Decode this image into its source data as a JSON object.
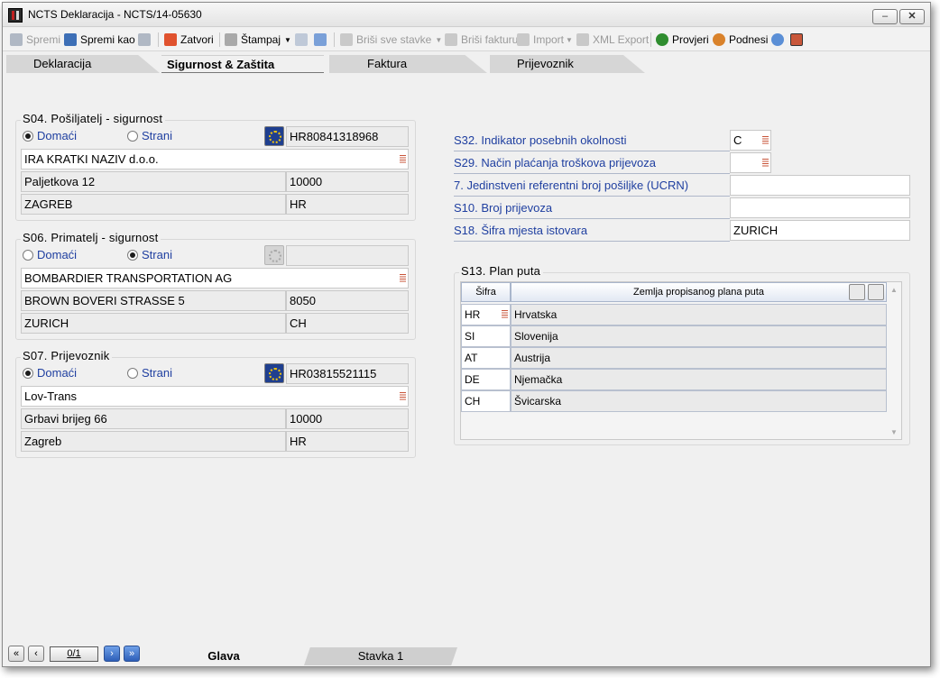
{
  "window": {
    "title": "NCTS Deklaracija - NCTS/14-05630"
  },
  "toolbar": {
    "spremi": "Spremi",
    "spremi_kao": "Spremi kao",
    "zatvori": "Zatvori",
    "stampaj": "Štampaj",
    "brisi_sve_stavke": "Briši sve stavke",
    "brisi_fakturu": "Briši fakturu",
    "import": "Import",
    "xml_export": "XML Export",
    "provjeri": "Provjeri",
    "podnesi": "Podnesi"
  },
  "tabs": [
    {
      "label": "Deklaracija"
    },
    {
      "label": "Sigurnost & Zaštita"
    },
    {
      "label": "Faktura"
    },
    {
      "label": "Prijevoznik"
    }
  ],
  "s04": {
    "title": "S04. Pošiljatelj - sigurnost",
    "radio_domaci": "Domaći",
    "radio_strani": "Strani",
    "selected": "domaci",
    "eori": "HR80841318968",
    "name": "IRA KRATKI NAZIV d.o.o.",
    "street": "Paljetkova 12",
    "postcode": "10000",
    "city": "ZAGREB",
    "country": "HR"
  },
  "s06": {
    "title": "S06. Primatelj - sigurnost",
    "radio_domaci": "Domaći",
    "radio_strani": "Strani",
    "selected": "strani",
    "eori": "",
    "name": "BOMBARDIER TRANSPORTATION AG",
    "street": "BROWN BOVERI STRASSE 5",
    "postcode": "8050",
    "city": "ZURICH",
    "country": "CH"
  },
  "s07": {
    "title": "S07. Prijevoznik",
    "radio_domaci": "Domaći",
    "radio_strani": "Strani",
    "selected": "domaci",
    "eori": "HR03815521115",
    "name": "Lov-Trans",
    "street": "Grbavi brijeg 66",
    "postcode": "10000",
    "city": "Zagreb",
    "country": "HR"
  },
  "right": {
    "s32_label": "S32. Indikator posebnih okolnosti",
    "s32_value": "C",
    "s29_label": "S29. Način plaćanja troškova prijevoza",
    "s29_value": "",
    "ucrn_label": "7. Jedinstveni referentni broj pošiljke (UCRN)",
    "ucrn_value": "",
    "s10_label": "S10. Broj prijevoza",
    "s10_value": "",
    "s18_label": "S18. Šifra mjesta istovara",
    "s18_value": "ZURICH"
  },
  "s13": {
    "title": "S13. Plan puta",
    "col_code": "Šifra",
    "col_country": "Zemlja propisanog plana puta",
    "rows": [
      {
        "code": "HR",
        "country": "Hrvatska"
      },
      {
        "code": "SI",
        "country": "Slovenija"
      },
      {
        "code": "AT",
        "country": "Austrija"
      },
      {
        "code": "DE",
        "country": "Njemačka"
      },
      {
        "code": "CH",
        "country": "Švicarska"
      }
    ]
  },
  "bottom": {
    "page": "0/1",
    "tab_glava": "Glava",
    "tab_stavka": "Stavka 1"
  }
}
